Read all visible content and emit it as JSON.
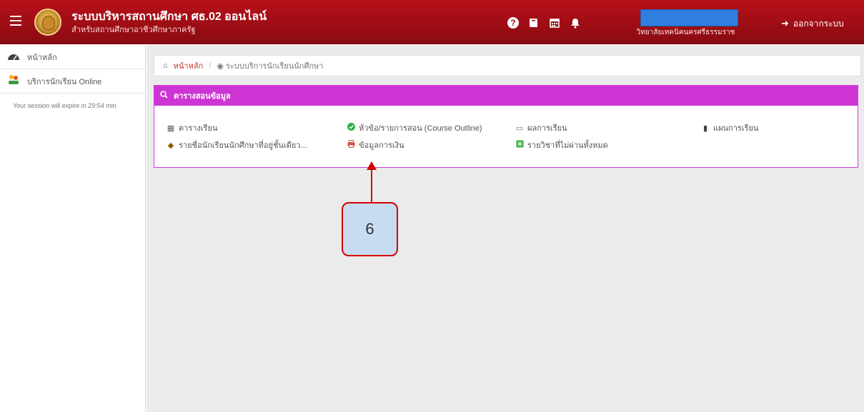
{
  "header": {
    "title": "ระบบบริหารสถานศึกษา ศธ.02 ออนไลน์",
    "subtitle": "สำหรับสถานศึกษาอาชีวศึกษาภาครัฐ",
    "org_name": "วิทยาลัยเทคนิคนครศรีธรรมราช",
    "logout_label": "ออกจากระบบ"
  },
  "sidebar": {
    "items": [
      {
        "label": "หน้าหลัก",
        "icon": "dashboard-icon"
      },
      {
        "label": "บริการนักเรียน Online",
        "icon": "hand-coins-icon"
      }
    ],
    "session_text": "Your session will expire in 29:54 min"
  },
  "breadcrumb": {
    "home": "หน้าหลัก",
    "current": "ระบบบริการนักเรียนนักศึกษา"
  },
  "panel": {
    "title": "ตารางสอนข้อมูล",
    "links": [
      {
        "label": "ตารางเรียน",
        "icon": "table-icon",
        "color": "#555555"
      },
      {
        "label": "หัวข้อ/รายการสอน (Course Outline)",
        "icon": "check-circle-icon",
        "color": "#2eae4a"
      },
      {
        "label": "ผลการเรียน",
        "icon": "folder-icon",
        "color": "#555555"
      },
      {
        "label": "แผนการเรียน",
        "icon": "book-icon",
        "color": "#444444"
      },
      {
        "label": "รายชื่อนักเรียนนักศึกษาที่อยู่ชั้นเดียว...",
        "icon": "graduation-cap-icon",
        "color": "#8a5a00"
      },
      {
        "label": "ข้อมูลการเงิน",
        "icon": "printer-icon",
        "color": "#d9534f"
      },
      {
        "label": "รายวิชาที่ไม่ผ่านทั้งหมด",
        "icon": "excel-file-icon",
        "color": "#3bb143"
      }
    ]
  },
  "annotation": {
    "number": "6"
  }
}
